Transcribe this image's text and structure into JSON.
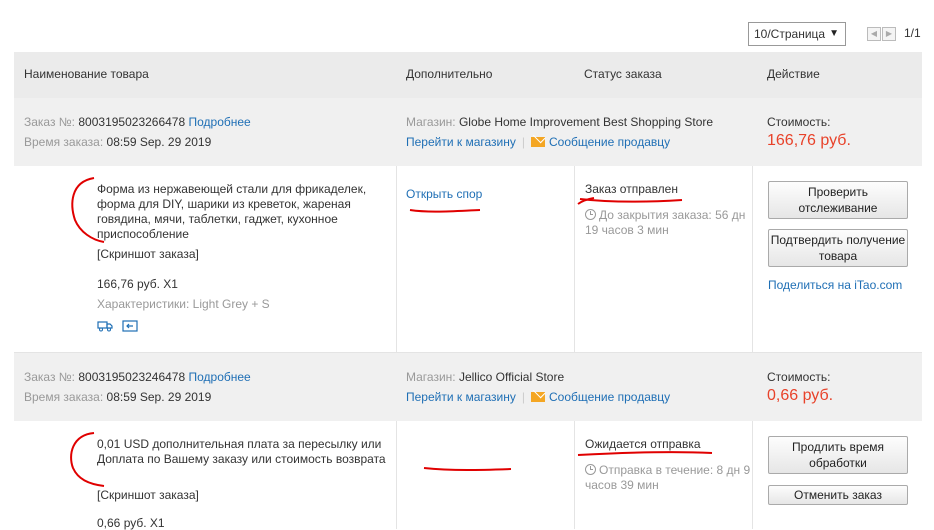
{
  "pager": {
    "per_page": "10/Страница",
    "page_count": "1/1"
  },
  "table_header": {
    "product": "Наименование товара",
    "extra": "Дополнительно",
    "status": "Статус заказа",
    "action": "Действие"
  },
  "orders": [
    {
      "order_no_label": "Заказ №:",
      "order_no": "8003195023266478",
      "details_link": "Подробнее",
      "time_label": "Время заказа:",
      "time": "08:59 Sep. 29 2019",
      "store_label": "Магазин:",
      "store": "Globe Home Improvement Best Shopping Store",
      "go_store": "Перейти к магазину",
      "message_seller": "Сообщение продавцу",
      "cost_label": "Стоимость:",
      "cost": "166,76 руб.",
      "product_title": "Форма из нержавеющей стали для фрикаделек, форма для DIY, шарики из креветок, жареная говядина, мячи, таблетки, гаджет, кухонное приспособление",
      "screenshot_link": "[Скриншот заказа]",
      "price_qty": "166,76 руб. X1",
      "specs": "Характеристики: Light Grey + S",
      "dispute_link": "Открыть спор",
      "status": "Заказ отправлен",
      "timer": "До закрытия заказа: 56 дн 19 часов 3 мин",
      "btn1": "Проверить отслеживание",
      "btn2": "Подтвердить получение товара",
      "share_text": "Поделиться на ",
      "share_site": "iTao.com"
    },
    {
      "order_no_label": "Заказ №:",
      "order_no": "8003195023246478",
      "details_link": "Подробнее",
      "time_label": "Время заказа:",
      "time": "08:59 Sep. 29 2019",
      "store_label": "Магазин:",
      "store": "Jellico Official Store",
      "go_store": "Перейти к магазину",
      "message_seller": "Сообщение продавцу",
      "cost_label": "Стоимость:",
      "cost": "0,66 руб.",
      "product_title": "0,01 USD дополнительная плата за пересылку или Доплата по Вашему заказу или стоимость возврата",
      "screenshot_link": "[Скриншот заказа]",
      "price_qty": "0,66 руб. X1",
      "status": "Ожидается отправка",
      "timer": "Отправка в течение: 8 дн 9 часов 39 мин",
      "btn1": "Продлить время обработки",
      "btn2": "Отменить заказ"
    }
  ],
  "colors": {
    "price": "#e8422a",
    "link": "#1f6fb5",
    "header_bg": "#ebebeb",
    "order_head_bg": "#f0f0f0",
    "annotation_red": "#e00000"
  }
}
